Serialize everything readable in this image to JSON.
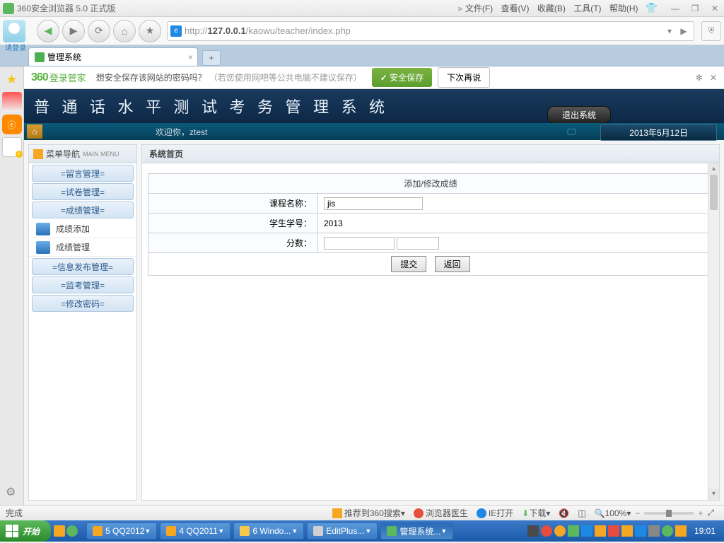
{
  "browser": {
    "title": "360安全浏览器 5.0 正式版",
    "login_label": "请登录",
    "menu": {
      "file": "文件(F)",
      "view": "查看(V)",
      "favorites": "收藏(B)",
      "tools": "工具(T)",
      "help": "帮助(H)"
    },
    "url_prefix": "http://",
    "url_host": "127.0.0.1",
    "url_path": "/kaowu/teacher/index.php",
    "tab_title": "管理系统",
    "newtab": "+"
  },
  "infobar": {
    "brand": "360",
    "brand2": "登录管家",
    "msg": "想安全保存该网站的密码吗？",
    "hint": "（若您使用网吧等公共电脑不建议保存）",
    "save": "安全保存",
    "later": "下次再说"
  },
  "app": {
    "title": "普 通 话 水 平 测 试 考 务 管 理 系 统",
    "logout": "退出系统",
    "welcome": "欢迎你，ztest",
    "date": "2013年5月12日",
    "menu_header": "菜单导航",
    "menu_header_sub": "MAIN MENU",
    "menu_items": [
      "=留言管理=",
      "=试卷管理=",
      "=成绩管理="
    ],
    "submenu_items": [
      "成绩添加",
      "成绩管理"
    ],
    "menu_items2": [
      "=信息发布管理=",
      "=监考管理=",
      "=修改密码="
    ],
    "content_title": "系统首页",
    "form": {
      "header": "添加/修改成绩",
      "course_label": "课程名称：",
      "course_value": "jis",
      "student_label": "学生学号：",
      "student_value": "2013",
      "score_label": "分数：",
      "score_value": "",
      "submit": "提交",
      "back": "返回"
    }
  },
  "statusbar": {
    "done": "完成",
    "recommend": "推荐到360搜索",
    "doctor": "浏览器医生",
    "ie": "IE打开",
    "download": "下载",
    "zoom": "100%"
  },
  "taskbar": {
    "start": "开始",
    "items": [
      {
        "label": "5 QQ2012",
        "color": "#f5a623"
      },
      {
        "label": "4 QQ2011",
        "color": "#f5a623"
      },
      {
        "label": "6 Windo...",
        "color": "#f5c94a"
      },
      {
        "label": "EditPlus...",
        "color": "#d0d0d0"
      },
      {
        "label": "管理系统...",
        "color": "#5cb85c",
        "active": true
      }
    ],
    "clock": "19:01"
  }
}
